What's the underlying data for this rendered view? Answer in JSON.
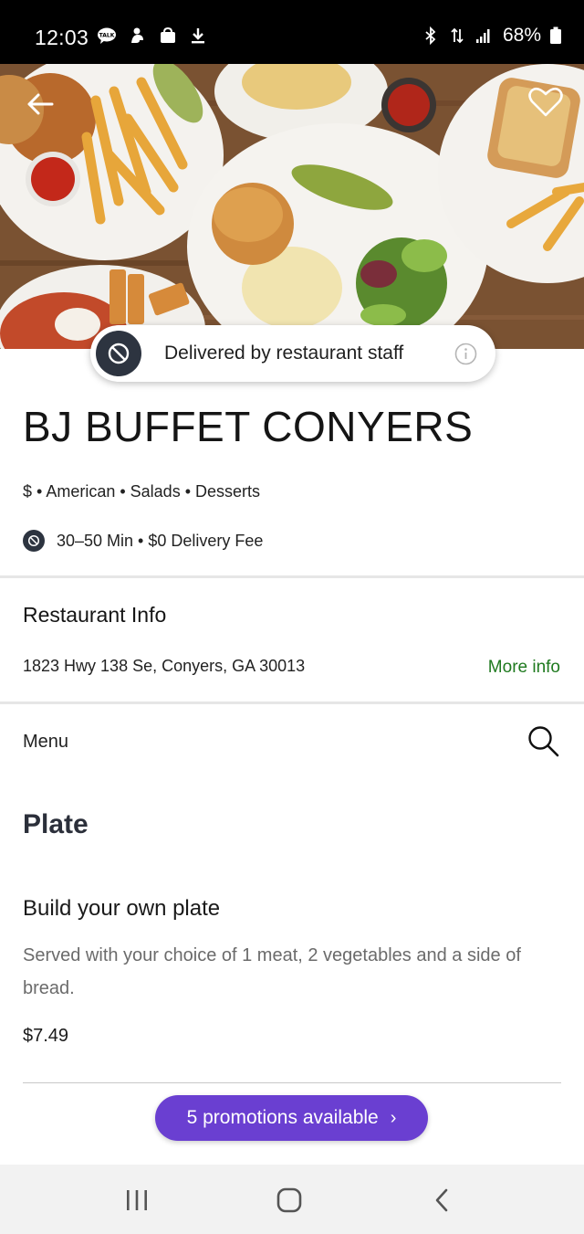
{
  "status_bar": {
    "time": "12:03",
    "battery": "68%",
    "left_icons": [
      "talk-icon",
      "app-icon",
      "bag-icon",
      "download-icon"
    ],
    "right_icons": [
      "bluetooth-icon",
      "data-transfer-icon",
      "signal-icon",
      "battery-icon"
    ]
  },
  "hero": {
    "back_icon": "arrow-left-icon",
    "favorite_icon": "heart-outline-icon"
  },
  "delivery_banner": {
    "text": "Delivered by restaurant staff",
    "badge_icon": "restaurant-delivery-icon",
    "info_icon": "info-icon"
  },
  "restaurant": {
    "name": "BJ BUFFET CONYERS",
    "cuisine_line": "$ • American • Salads • Desserts",
    "delivery_line": "30–50 Min • $0 Delivery Fee"
  },
  "info_section": {
    "heading": "Restaurant Info",
    "address": "1823 Hwy 138 Se, Conyers, GA 30013",
    "more_info_label": "More info"
  },
  "menu": {
    "label": "Menu",
    "search_icon": "search-icon",
    "category": "Plate",
    "items": [
      {
        "name": "Build your own plate",
        "description": "Served with your choice of 1 meat, 2 vegetables and a side of bread.",
        "price": "$7.49"
      }
    ]
  },
  "promo": {
    "label": "5 promotions available",
    "chevron": "›"
  },
  "navbar": {
    "icons": [
      "recents-icon",
      "home-icon",
      "back-icon"
    ]
  },
  "colors": {
    "accent_green": "#1f7a1f",
    "promo_purple": "#6a3fd1",
    "badge_dark": "#2d3440"
  }
}
